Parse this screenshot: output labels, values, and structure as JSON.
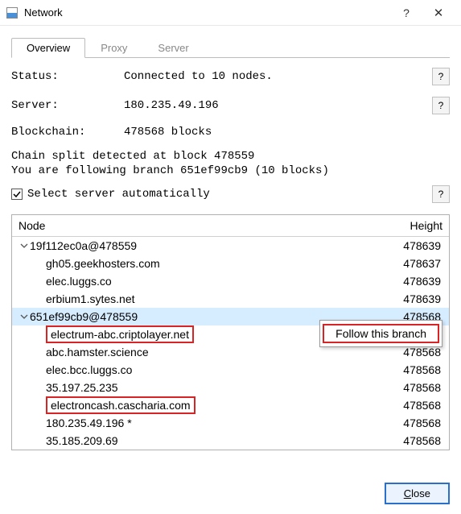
{
  "window": {
    "title": "Network",
    "help_glyph": "?",
    "close_glyph": "✕"
  },
  "tabs": [
    {
      "label": "Overview",
      "active": true
    },
    {
      "label": "Proxy",
      "active": false
    },
    {
      "label": "Server",
      "active": false
    }
  ],
  "fields": {
    "status_label": "Status:",
    "status_value": "Connected to 10 nodes.",
    "server_label": "Server:",
    "server_value": "180.235.49.196",
    "blockchain_label": "Blockchain:",
    "blockchain_value": "478568 blocks"
  },
  "chain_split_line": "Chain split detected at block 478559",
  "branch_line": "You are following branch 651ef99cb9 (10 blocks)",
  "auto_select": {
    "label": "Select server automatically",
    "checked": true
  },
  "help_glyph": "?",
  "table": {
    "col_node": "Node",
    "col_height": "Height"
  },
  "branches": [
    {
      "header": "19f112ec0a@478559",
      "height": "478639",
      "nodes": [
        {
          "name": "gh05.geekhosters.com",
          "height": "478637",
          "red": false
        },
        {
          "name": "elec.luggs.co",
          "height": "478639",
          "red": false
        },
        {
          "name": "erbium1.sytes.net",
          "height": "478639",
          "red": false
        }
      ],
      "selected": false
    },
    {
      "header": "651ef99cb9@478559",
      "height": "478568",
      "nodes": [
        {
          "name": "electrum-abc.criptolayer.net",
          "height": "",
          "red": true
        },
        {
          "name": "abc.hamster.science",
          "height": "478568",
          "red": false
        },
        {
          "name": "elec.bcc.luggs.co",
          "height": "478568",
          "red": false
        },
        {
          "name": "35.197.25.235",
          "height": "478568",
          "red": false
        },
        {
          "name": "electroncash.cascharia.com",
          "height": "478568",
          "red": true
        },
        {
          "name": "180.235.49.196 *",
          "height": "478568",
          "red": false
        },
        {
          "name": "35.185.209.69",
          "height": "478568",
          "red": false
        }
      ],
      "selected": true
    }
  ],
  "context_menu": {
    "item": "Follow this branch"
  },
  "footer": {
    "close": "Close",
    "close_accel_pos": 0
  }
}
